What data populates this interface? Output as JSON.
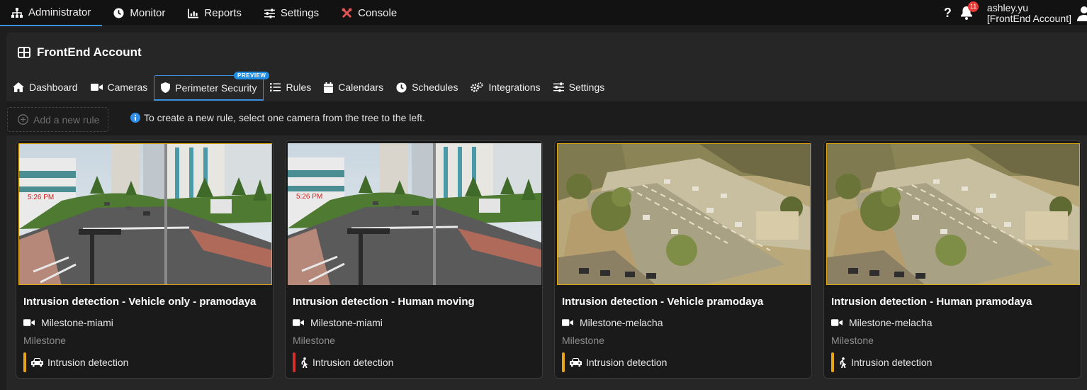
{
  "topnav": {
    "items": [
      {
        "label": "Administrator",
        "icon": "sitemap-icon",
        "active": true
      },
      {
        "label": "Monitor",
        "icon": "clock-icon"
      },
      {
        "label": "Reports",
        "icon": "chart-icon"
      },
      {
        "label": "Settings",
        "icon": "sliders-icon"
      },
      {
        "label": "Console",
        "icon": "tools-icon"
      }
    ],
    "help": "?",
    "notifications": "11",
    "user_name": "ashley.yu",
    "user_account": "[FrontEnd Account]"
  },
  "panel": {
    "title": "FrontEnd Account",
    "tabs": [
      {
        "label": "Dashboard",
        "icon": "home-icon"
      },
      {
        "label": "Cameras",
        "icon": "video-icon"
      },
      {
        "label": "Perimeter Security",
        "icon": "shield-icon",
        "active": true,
        "badge": "PREVIEW"
      },
      {
        "label": "Rules",
        "icon": "list-icon"
      },
      {
        "label": "Calendars",
        "icon": "calendar-icon"
      },
      {
        "label": "Schedules",
        "icon": "clock-icon"
      },
      {
        "label": "Integrations",
        "icon": "cogs-icon"
      },
      {
        "label": "Settings",
        "icon": "sliders-icon"
      }
    ]
  },
  "toolbar": {
    "add_rule": "Add a new rule",
    "hint": "To create a new rule, select one camera from the tree to the left."
  },
  "colors": {
    "accent": "#3d8fe0",
    "vehicle": "#e8a317",
    "human_alert": "#d32f2f",
    "human_normal": "#e8a317"
  },
  "rules": [
    {
      "title": "Intrusion detection - Vehicle only - pramodaya",
      "camera": "Milestone-miami",
      "vendor": "Milestone",
      "type": "Intrusion detection",
      "type_icon": "car-icon",
      "status_color": "#e8a317",
      "scene": "miami",
      "selected": true
    },
    {
      "title": "Intrusion detection - Human moving",
      "camera": "Milestone-miami",
      "vendor": "Milestone",
      "type": "Intrusion detection",
      "type_icon": "walking-icon",
      "status_color": "#d32f2f",
      "scene": "miami",
      "selected": false
    },
    {
      "title": "Intrusion detection - Vehicle pramodaya",
      "camera": "Milestone-melacha",
      "vendor": "Milestone",
      "type": "Intrusion detection",
      "type_icon": "car-icon",
      "status_color": "#e8a317",
      "scene": "melacha",
      "selected": true
    },
    {
      "title": "Intrusion detection - Human pramodaya",
      "camera": "Milestone-melacha",
      "vendor": "Milestone",
      "type": "Intrusion detection",
      "type_icon": "walking-icon",
      "status_color": "#e8a317",
      "scene": "melacha",
      "selected": true
    }
  ]
}
